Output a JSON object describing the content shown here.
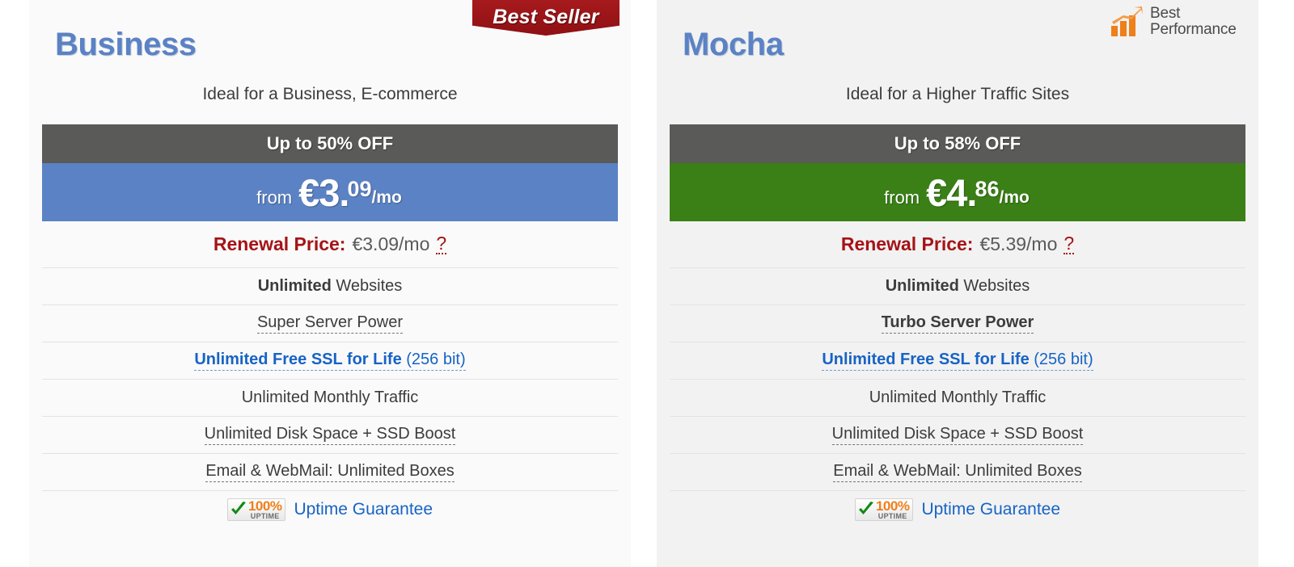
{
  "cards": [
    {
      "title": "Business",
      "subtitle": "Ideal for a Business, E-commerce",
      "badge": {
        "kind": "best-seller",
        "label": "Best Seller"
      },
      "discount": "Up to 50% OFF",
      "price": {
        "from": "from",
        "amount": "€3.",
        "cents": "09",
        "period": "/mo",
        "accent": "#5b82c4"
      },
      "renewal": {
        "label": "Renewal Price:",
        "value": "€3.09/mo",
        "help": "?"
      },
      "features": [
        {
          "strong": "Unlimited",
          "rest": " Websites",
          "style": "mixed-bold"
        },
        {
          "text": "Super Server Power",
          "style": "dotted"
        },
        {
          "strong": "Unlimited Free SSL for Life",
          "rest": " (256 bit)",
          "style": "link"
        },
        {
          "text": "Unlimited Monthly Traffic",
          "style": "plain"
        },
        {
          "text": "Unlimited Disk Space + SSD Boost",
          "style": "dotted"
        },
        {
          "text": "Email & WebMail: Unlimited Boxes",
          "style": "dotted"
        }
      ],
      "uptime": {
        "percent": "100%",
        "word": "UPTIME",
        "label": "Uptime Guarantee"
      }
    },
    {
      "title": "Mocha",
      "subtitle": "Ideal for a Higher Traffic Sites",
      "badge": {
        "kind": "best-performance",
        "line1": "Best",
        "line2": "Performance"
      },
      "discount": "Up to 58% OFF",
      "price": {
        "from": "from",
        "amount": "€4.",
        "cents": "86",
        "period": "/mo",
        "accent": "#3a8016"
      },
      "renewal": {
        "label": "Renewal Price:",
        "value": "€5.39/mo",
        "help": "?"
      },
      "features": [
        {
          "strong": "Unlimited",
          "rest": " Websites",
          "style": "mixed-bold"
        },
        {
          "text": "Turbo Server Power",
          "style": "dotted-bold"
        },
        {
          "strong": "Unlimited Free SSL for Life",
          "rest": " (256 bit)",
          "style": "link"
        },
        {
          "text": "Unlimited Monthly Traffic",
          "style": "plain"
        },
        {
          "text": "Unlimited Disk Space + SSD Boost",
          "style": "dotted"
        },
        {
          "text": "Email & WebMail: Unlimited Boxes",
          "style": "dotted"
        }
      ],
      "uptime": {
        "percent": "100%",
        "word": "UPTIME",
        "label": "Uptime Guarantee"
      }
    }
  ],
  "colors": {
    "title_blue": "#5b82c4",
    "discount_gray": "#5a5a58",
    "renewal_red": "#a51317",
    "link_blue": "#1763c6",
    "ribbon_red": "#9e1216",
    "badge_orange": "#ef7f1a"
  }
}
